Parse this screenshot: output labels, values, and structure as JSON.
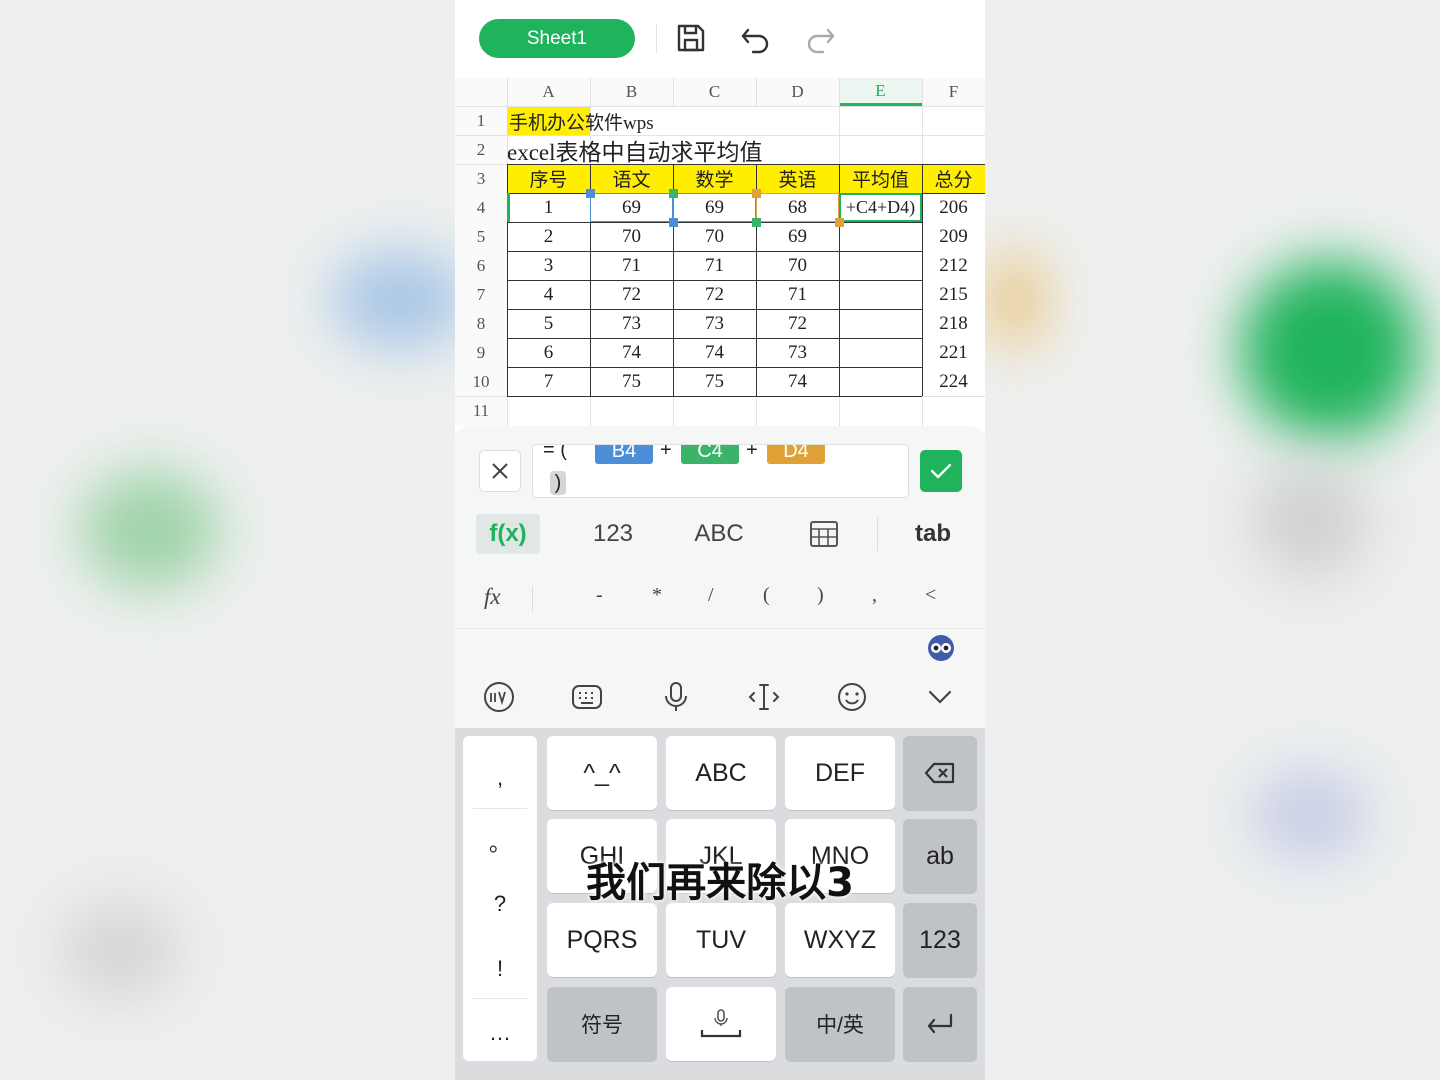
{
  "toolbar": {
    "sheet_tab": "Sheet1",
    "icons": [
      "save-icon",
      "undo-icon",
      "redo-icon"
    ]
  },
  "grid": {
    "columns": [
      "A",
      "B",
      "C",
      "D",
      "E",
      "F"
    ],
    "rows": [
      "1",
      "2",
      "3",
      "4",
      "5",
      "6",
      "7",
      "8",
      "9",
      "10",
      "11"
    ],
    "a1": "手机办公软件wps",
    "a2": "excel表格中自动求平均值",
    "headers": [
      "序号",
      "语文",
      "数学",
      "英语",
      "平均值",
      "总分"
    ],
    "data": [
      [
        "1",
        "69",
        "69",
        "68",
        "+C4+D4)",
        "206"
      ],
      [
        "2",
        "70",
        "70",
        "69",
        "",
        "209"
      ],
      [
        "3",
        "71",
        "71",
        "70",
        "",
        "212"
      ],
      [
        "4",
        "72",
        "72",
        "71",
        "",
        "215"
      ],
      [
        "5",
        "73",
        "73",
        "72",
        "",
        "218"
      ],
      [
        "6",
        "74",
        "74",
        "73",
        "",
        "221"
      ],
      [
        "7",
        "75",
        "75",
        "74",
        "",
        "224"
      ]
    ],
    "selected_column": "E",
    "colors": {
      "highlight": "#ffee00",
      "selection": "#1fb35b"
    }
  },
  "formula": {
    "prefix": "= (",
    "tokens": [
      {
        "ref": "B4",
        "color": "#4a8fd8"
      },
      {
        "ref": "C4",
        "color": "#3bb36a"
      },
      {
        "ref": "D4",
        "color": "#e0a236"
      }
    ],
    "plus": "+",
    "close": ")",
    "confirm_color": "#1fb35b"
  },
  "modes": {
    "fx": "f(x)",
    "num": "123",
    "abc": "ABC",
    "tab": "tab"
  },
  "symbols": {
    "fx": "fx",
    "items": [
      "-",
      "*",
      "/",
      "(",
      ")",
      ",",
      "<"
    ]
  },
  "keyboard": {
    "side": [
      ",",
      "。",
      "?",
      "!",
      "…"
    ],
    "row1": [
      "^_^",
      "ABC",
      "DEF"
    ],
    "row2": [
      "GHI",
      "JKL",
      "MNO",
      "ab"
    ],
    "row3": [
      "PQRS",
      "TUV",
      "WXYZ",
      "123"
    ],
    "row4": [
      "符号",
      "中/英"
    ],
    "toolbar_icons": [
      "ime-logo-icon",
      "keyboard-icon",
      "microphone-icon",
      "cursor-move-icon",
      "emoji-icon",
      "collapse-icon"
    ]
  },
  "subtitle": "我们再来除以3"
}
